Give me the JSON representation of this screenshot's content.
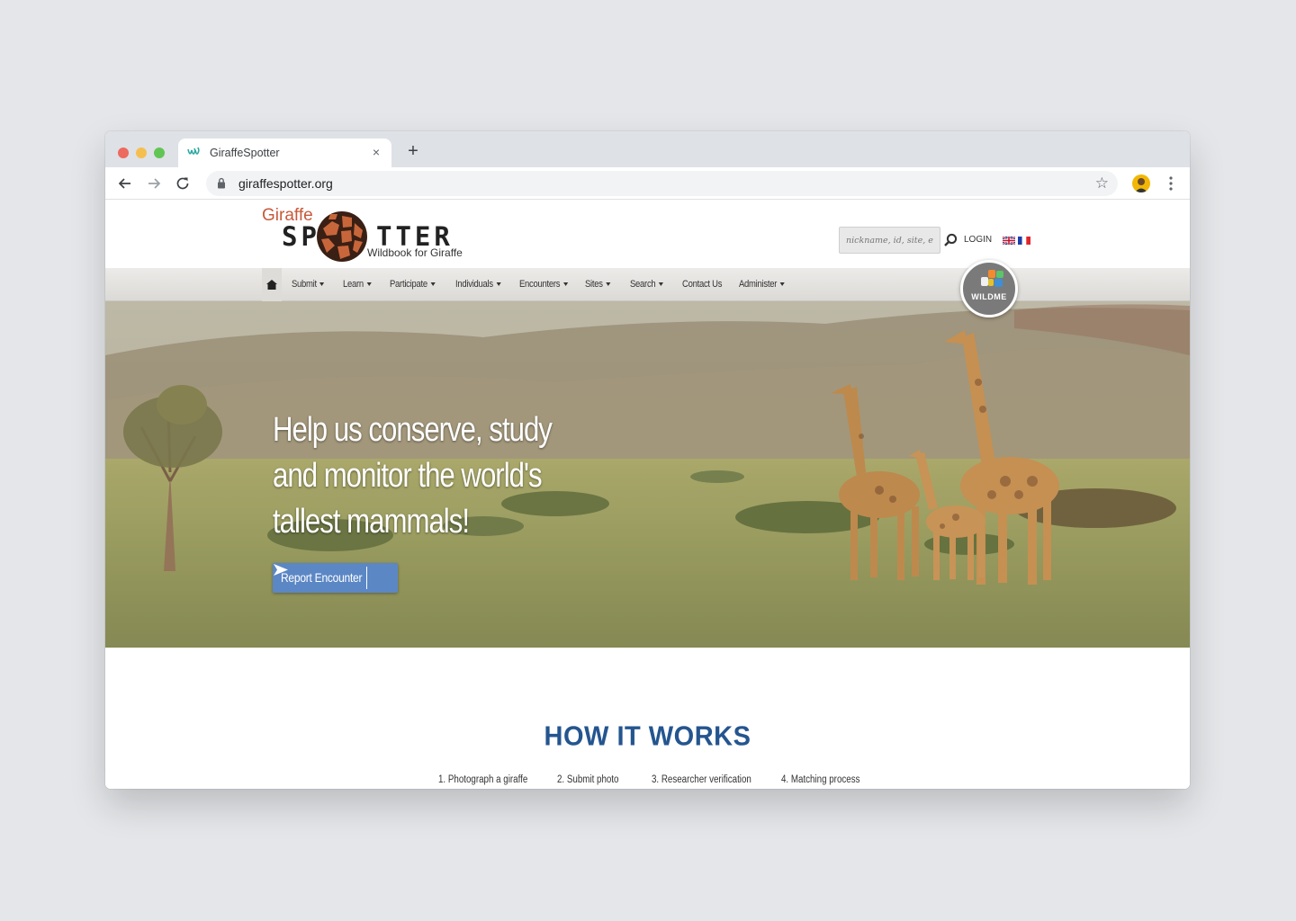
{
  "browser": {
    "tab_title": "GiraffeSpotter",
    "new_tab_label": "+",
    "close_tab_label": "×",
    "url": "giraffespotter.org",
    "star_label": "☆"
  },
  "site": {
    "logo": {
      "giraffe": "Giraffe",
      "sp": "SP",
      "tter": "TTER",
      "subtitle": "Wildbook for Giraffe"
    },
    "search": {
      "placeholder": "nickname, id, site, encounter"
    },
    "login_label": "LOGIN",
    "nav": {
      "items": [
        {
          "label": "Submit",
          "dropdown": true
        },
        {
          "label": "Learn",
          "dropdown": true
        },
        {
          "label": "Participate",
          "dropdown": true
        },
        {
          "label": "Individuals",
          "dropdown": true
        },
        {
          "label": "Encounters",
          "dropdown": true
        },
        {
          "label": "Sites",
          "dropdown": true
        },
        {
          "label": "Search",
          "dropdown": true
        },
        {
          "label": "Contact Us",
          "dropdown": false
        },
        {
          "label": "Administer",
          "dropdown": true
        }
      ]
    },
    "wildme_badge": {
      "text": "WILDME"
    },
    "hero": {
      "headline": "Help us conserve, study and monitor the world's tallest mammals!",
      "button_label": "Report Encounter"
    },
    "how_it_works": {
      "title": "HOW IT WORKS",
      "steps": [
        "1. Photograph a giraffe",
        "2. Submit photo",
        "3. Researcher verification",
        "4. Matching process"
      ]
    }
  }
}
